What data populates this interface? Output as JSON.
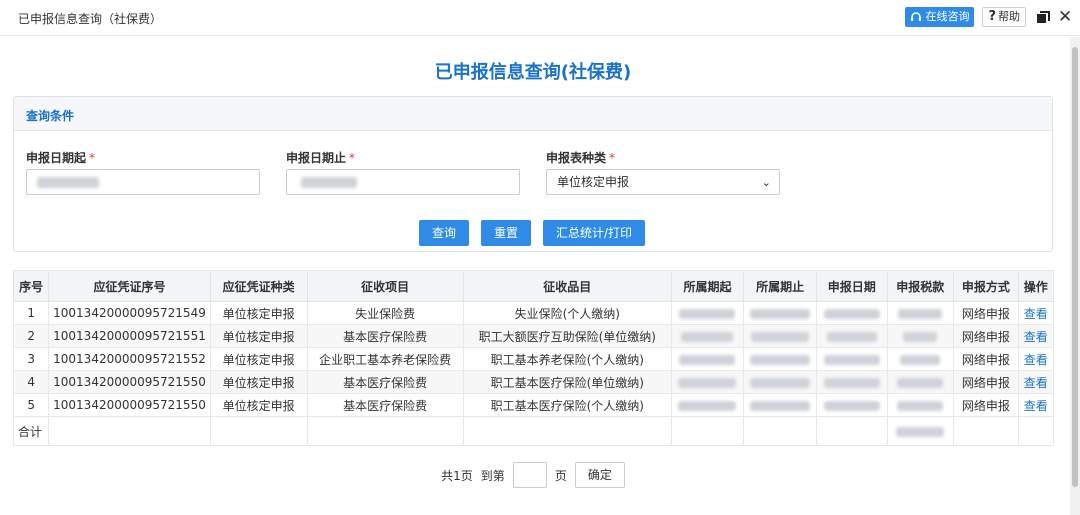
{
  "window": {
    "title": "已申报信息查询（社保费）",
    "online_label": "在线咨询",
    "help_label": "帮助"
  },
  "page": {
    "title": "已申报信息查询(社保费)"
  },
  "query": {
    "header": "查询条件",
    "date_start_label": "申报日期起",
    "date_end_label": "申报日期止",
    "form_type_label": "申报表种类",
    "required_mark": "*",
    "form_type_value": "单位核定申报",
    "buttons": {
      "search": "查询",
      "reset": "重置",
      "summary": "汇总统计/打印"
    }
  },
  "table": {
    "columns": [
      "序号",
      "应征凭证序号",
      "应征凭证种类",
      "征收项目",
      "征收品目",
      "所属期起",
      "所属期止",
      "申报日期",
      "申报税款",
      "申报方式",
      "操作"
    ],
    "rows": [
      {
        "seq": "1",
        "voucher": "10013420000095721549",
        "vtype": "单位核定申报",
        "item": "失业保险费",
        "subitem": "失业保险(个人缴纳)",
        "method": "网络申报",
        "action": "查看"
      },
      {
        "seq": "2",
        "voucher": "10013420000095721551",
        "vtype": "单位核定申报",
        "item": "基本医疗保险费",
        "subitem": "职工大额医疗互助保险(单位缴纳)",
        "method": "网络申报",
        "action": "查看"
      },
      {
        "seq": "3",
        "voucher": "10013420000095721552",
        "vtype": "单位核定申报",
        "item": "企业职工基本养老保险费",
        "subitem": "职工基本养老保险(个人缴纳)",
        "method": "网络申报",
        "action": "查看"
      },
      {
        "seq": "4",
        "voucher": "10013420000095721550",
        "vtype": "单位核定申报",
        "item": "基本医疗保险费",
        "subitem": "职工基本医疗保险(单位缴纳)",
        "method": "网络申报",
        "action": "查看"
      },
      {
        "seq": "5",
        "voucher": "10013420000095721550",
        "vtype": "单位核定申报",
        "item": "基本医疗保险费",
        "subitem": "职工基本医疗保险(个人缴纳)",
        "method": "网络申报",
        "action": "查看"
      }
    ],
    "total_label": "合计"
  },
  "pager": {
    "total_pages": "共1页",
    "goto_label": "到第",
    "page_unit": "页",
    "confirm": "确定"
  },
  "colors": {
    "accent": "#2f8be6",
    "title": "#1a73c9",
    "required": "#e4393c"
  }
}
